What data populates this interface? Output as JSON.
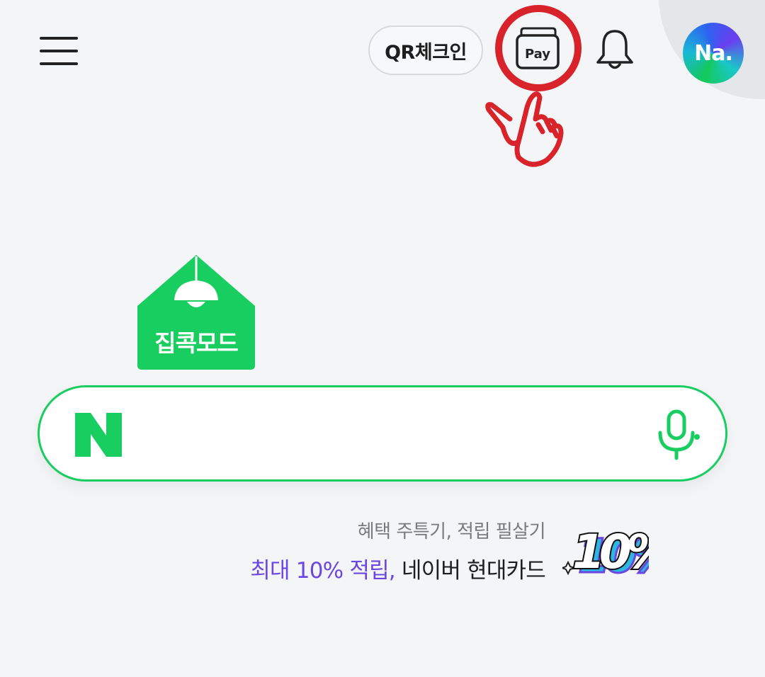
{
  "header": {
    "qr_checkin_label": "QR체크인",
    "pay_label": "Pay",
    "avatar_text": "Na."
  },
  "house_mode": {
    "label": "집콕모드"
  },
  "search": {
    "logo_text": "N",
    "placeholder": ""
  },
  "promo": {
    "subtitle": "혜택 주특기, 적립 필살기",
    "highlight": "최대 10% 적립,",
    "rest": " 네이버 현대카드",
    "badge_text": "10%"
  },
  "colors": {
    "naver_green": "#19ce60",
    "highlight_purple": "#6b46e0",
    "annotation_red": "#d8232a"
  },
  "icons": [
    "menu-icon",
    "pay-wallet-icon",
    "bell-icon",
    "lamp-icon",
    "microphone-icon",
    "pointing-hand-icon"
  ]
}
